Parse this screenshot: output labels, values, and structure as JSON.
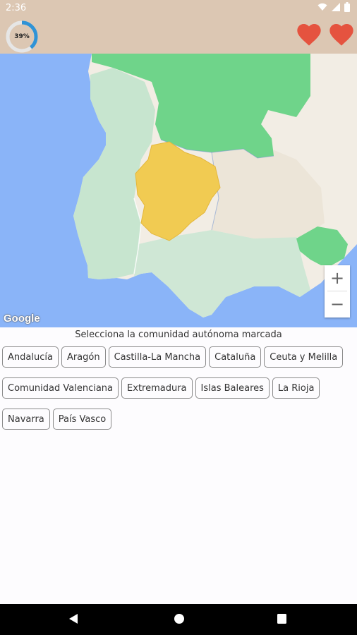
{
  "status_bar": {
    "time": "2:36"
  },
  "app_bar": {
    "progress_label": "39%",
    "progress_value": 0.39,
    "lives": 2,
    "colors": {
      "background": "#dcc7b3",
      "heart": "#e5533f",
      "ring": "#2f93d6"
    }
  },
  "map": {
    "attribution": "Google",
    "zoom_in_label": "+",
    "zoom_out_label": "−",
    "highlight_color": "#f1cb52"
  },
  "question": {
    "prompt": "Selecciona la comunidad autónoma marcada"
  },
  "options": [
    [
      "Andalucía",
      "Aragón",
      "Castilla-La Mancha",
      "Cataluña",
      "Ceuta y Melilla"
    ],
    [
      "Comunidad Valenciana",
      "Extremadura",
      "Islas Baleares",
      "La Rioja"
    ],
    [
      "Navarra",
      "País Vasco"
    ]
  ]
}
